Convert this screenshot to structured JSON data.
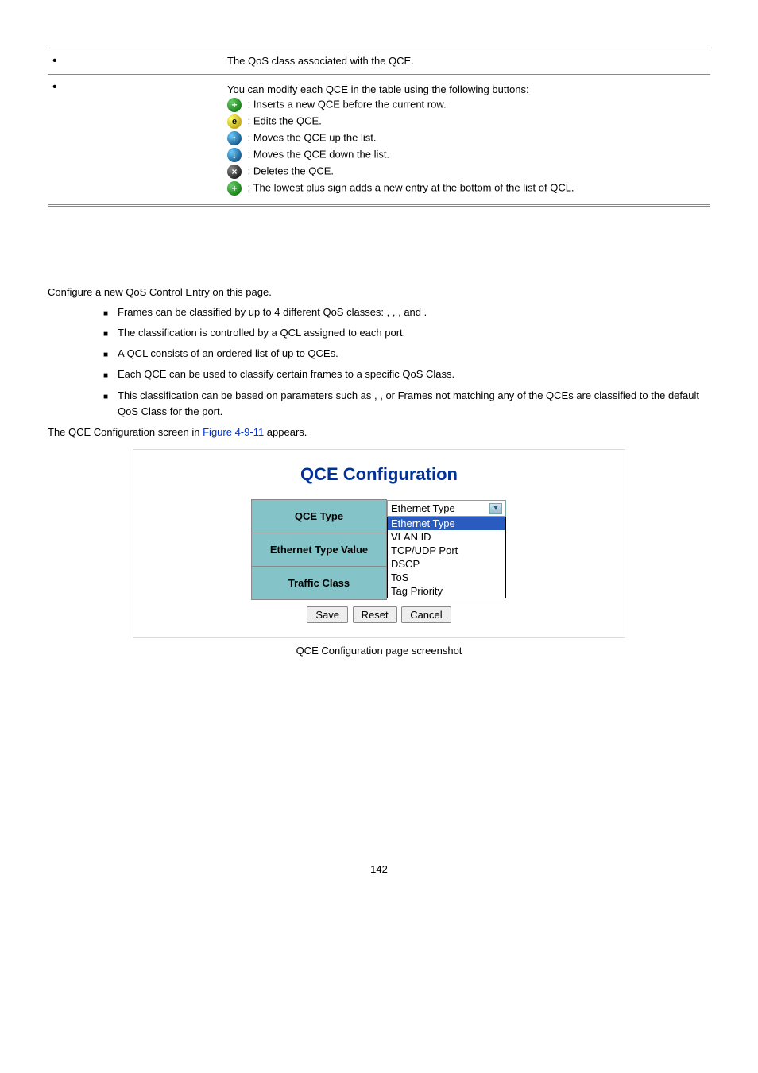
{
  "table_top": {
    "row1_text": "The QoS class associated with the QCE.",
    "row2_intro": "You can modify each QCE in the table using the following buttons:",
    "items": [
      {
        "icon": "plus-green",
        "text": ": Inserts a new QCE before the current row."
      },
      {
        "icon": "e-yellow",
        "text": ": Edits the QCE."
      },
      {
        "icon": "up-blue",
        "text": ": Moves the QCE up the list."
      },
      {
        "icon": "down-blue",
        "text": ": Moves the QCE down the list."
      },
      {
        "icon": "x-dark",
        "text": ": Deletes the QCE."
      },
      {
        "icon": "plus-green",
        "text": ": The lowest plus sign adds a new entry at the bottom of the list of QCL."
      }
    ]
  },
  "intro": "Configure a new QoS Control Entry on this page.",
  "bullets": [
    "Frames can be classified by up to 4 different QoS classes:      ,         ,         , and      .",
    "The classification is controlled by a QCL assigned to each port.",
    "A QCL consists of an ordered list of up to     QCEs.",
    "Each QCE can be used to classify certain frames to a specific QoS Class.",
    "This classification can be based on parameters such as                  ,                      ,                      or                 Frames not matching any of the QCEs are classified to the default QoS Class for the port."
  ],
  "figline_pre": "The QCE Configuration screen in ",
  "figline_link": "Figure 4-9-11",
  "figline_post": " appears.",
  "qce": {
    "title": "QCE Configuration",
    "rows": [
      {
        "label": "QCE Type"
      },
      {
        "label": "Ethernet Type Value"
      },
      {
        "label": "Traffic Class"
      }
    ],
    "dropdown_selected": "Ethernet Type",
    "dropdown_options": [
      "Ethernet Type",
      "VLAN ID",
      "TCP/UDP Port",
      "DSCP",
      "ToS",
      "Tag Priority"
    ],
    "buttons": {
      "save": "Save",
      "reset": "Reset",
      "cancel": "Cancel"
    }
  },
  "caption": "QCE Configuration page screenshot",
  "page_number": "142"
}
